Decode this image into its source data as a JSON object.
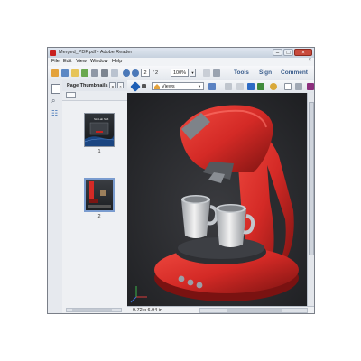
{
  "window": {
    "title": "Merged_PDF.pdf - Adobe Reader",
    "minimize": "–",
    "maximize": "□",
    "close": "×"
  },
  "menu": {
    "items": [
      "File",
      "Edit",
      "View",
      "Window",
      "Help"
    ],
    "close": "×"
  },
  "toolbar": {
    "page_current": "2",
    "page_total": "/ 2",
    "zoom": "100%",
    "tools_label": "Tools",
    "sign_label": "Sign",
    "comment_label": "Comment"
  },
  "thumbnails": {
    "title": "Page Thumbnails",
    "pages": [
      "1",
      "2"
    ],
    "thumb1_text": "SimLab Soft"
  },
  "toolbar3d": {
    "views_label": "Views"
  },
  "status": {
    "page_size": "9.72 x 6.94 in"
  },
  "colors": {
    "accent": "#3a5d8c",
    "machine_red": "#d42a26",
    "viewport_bg": "#2a2b2e"
  }
}
